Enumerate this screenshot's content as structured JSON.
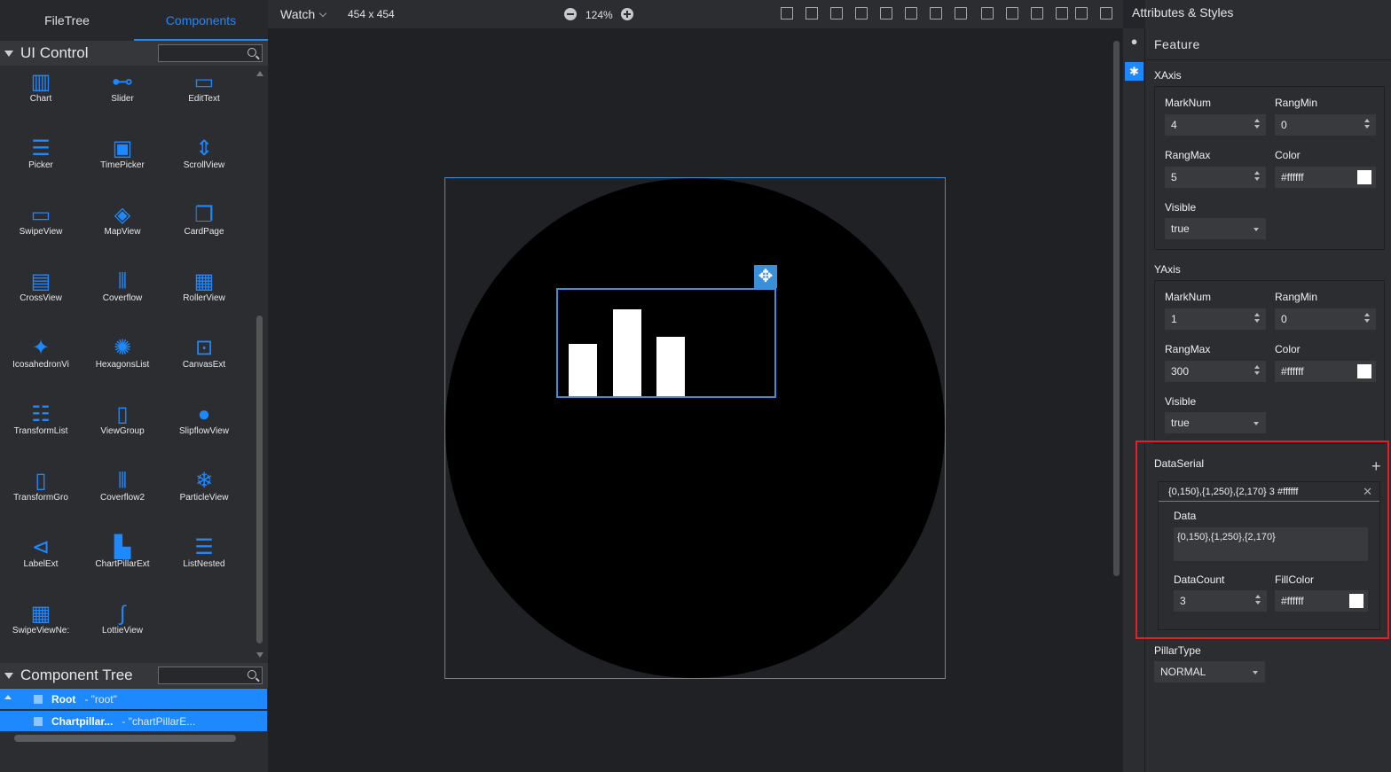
{
  "left_tabs": [
    "FileTree",
    "Components"
  ],
  "ui_control": {
    "title": "UI Control",
    "items": [
      "Chart",
      "Slider",
      "EditText",
      "Picker",
      "TimePicker",
      "ScrollView",
      "SwipeView",
      "MapView",
      "CardPage",
      "CrossView",
      "Coverflow",
      "RollerView",
      "IcosahedronVi",
      "HexagonsList",
      "CanvasExt",
      "TransformList",
      "ViewGroup",
      "SlipflowView",
      "TransformGro",
      "Coverflow2",
      "ParticleView",
      "LabelExt",
      "ChartPillarExt",
      "ListNested",
      "SwipeViewNe:",
      "LottieView"
    ]
  },
  "component_tree": {
    "title": "Component Tree",
    "rows": [
      {
        "name": "Root",
        "id": "- \"root\""
      },
      {
        "name": "Chartpillar...",
        "id": "- \"chartPillarE..."
      }
    ]
  },
  "toolbar": {
    "device": "Watch",
    "size": "454 x 454",
    "zoom": "124%"
  },
  "canvas": {
    "bars": [
      150,
      250,
      170
    ],
    "y_max": 300,
    "mark_num": 4
  },
  "right": {
    "title": "Attributes & Styles",
    "feature": "Feature",
    "xaxis": {
      "title": "XAxis",
      "marknum_label": "MarkNum",
      "marknum": "4",
      "rangmin_label": "RangMin",
      "rangmin": "0",
      "rangmax_label": "RangMax",
      "rangmax": "5",
      "color_label": "Color",
      "color": "#ffffff",
      "visible_label": "Visible",
      "visible": "true"
    },
    "yaxis": {
      "title": "YAxis",
      "marknum_label": "MarkNum",
      "marknum": "1",
      "rangmin_label": "RangMin",
      "rangmin": "0",
      "rangmax_label": "RangMax",
      "rangmax": "300",
      "color_label": "Color",
      "color": "#ffffff",
      "visible_label": "Visible",
      "visible": "true"
    },
    "dataserial": {
      "title": "DataSerial",
      "summary": "{0,150},{1,250},{2,170} 3 #ffffff",
      "data_label": "Data",
      "data": "{0,150},{1,250},{2,170}",
      "count_label": "DataCount",
      "count": "3",
      "fill_label": "FillColor",
      "fill": "#ffffff"
    },
    "pillar": {
      "title": "PillarType",
      "value": "NORMAL"
    }
  },
  "colors": {
    "accent": "#1e88ff",
    "highlight": "#e0202a"
  }
}
